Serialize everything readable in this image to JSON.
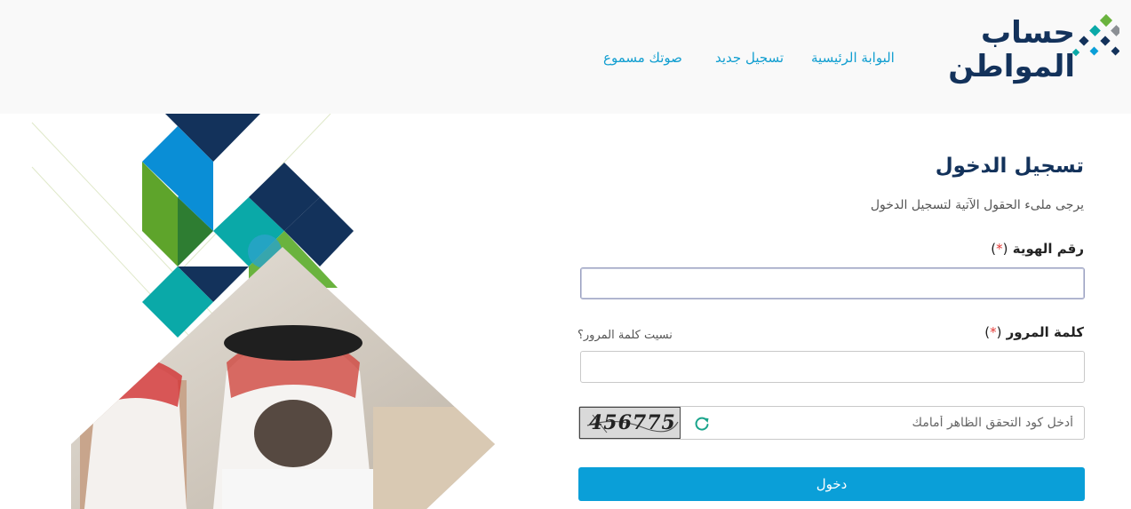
{
  "header": {
    "logo_text_line1": "حساب",
    "logo_text_line2": "المواطن",
    "nav": {
      "home": "البوابة الرئيسية",
      "register": "تسجيل جديد",
      "voice": "صوتك مسموع"
    }
  },
  "form": {
    "title": "تسجيل الدخول",
    "subtitle": "يرجى ملىء الحقول الآتية لتسجيل الدخول",
    "id_label": "رقم الهوية",
    "password_label": "كلمة المرور",
    "required_open": "(",
    "required_star": "*",
    "required_close": ")",
    "forgot_password": "نسيت كلمة المرور؟",
    "captcha_placeholder": "أدخل كود التحقق الظاهر أمامك",
    "captcha_code": "456775",
    "submit": "دخول"
  },
  "colors": {
    "navy": "#13325b",
    "accent_blue": "#0a9fd8",
    "teal": "#0aa9a8",
    "green": "#5ea42b",
    "required": "#e53935"
  },
  "icons": {
    "refresh": "refresh-icon"
  }
}
